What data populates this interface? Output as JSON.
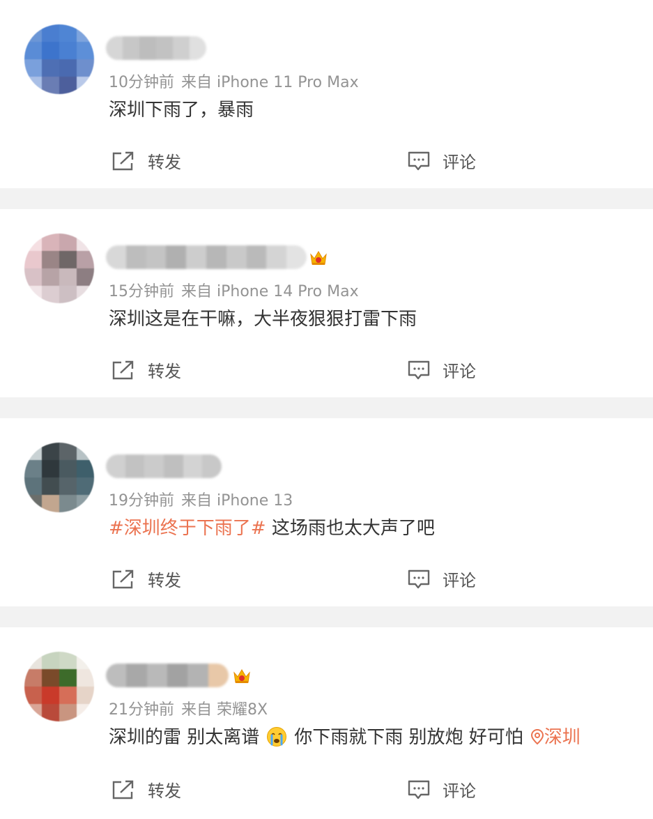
{
  "posts": [
    {
      "time": "10分钟前",
      "source": "来自 iPhone 11 Pro Max",
      "text": "深圳下雨了，暴雨",
      "forward_label": "转发",
      "comment_label": "评论"
    },
    {
      "time": "15分钟前",
      "source": "来自 iPhone 14 Pro Max",
      "text": "深圳这是在干嘛，大半夜狠狠打雷下雨",
      "forward_label": "转发",
      "comment_label": "评论",
      "badge_icon": "vip-crown-icon"
    },
    {
      "time": "19分钟前",
      "source": "来自 iPhone 13",
      "topic": "#深圳终于下雨了#",
      "text": " 这场雨也太大声了吧",
      "forward_label": "转发",
      "comment_label": "评论"
    },
    {
      "time": "21分钟前",
      "source": "来自 荣耀8X",
      "text_part1": "深圳的雷 别太离谱",
      "emoji_icon": "crying-face-icon",
      "text_part2": "你下雨就下雨 别放炮 好可怕",
      "location": "深圳",
      "forward_label": "转发",
      "comment_label": "评论",
      "badge_icon": "vip-crown-icon"
    }
  ],
  "colors": {
    "topic": "#eb7350",
    "meta": "#939393",
    "text": "#333333",
    "separator": "#f2f2f2"
  }
}
